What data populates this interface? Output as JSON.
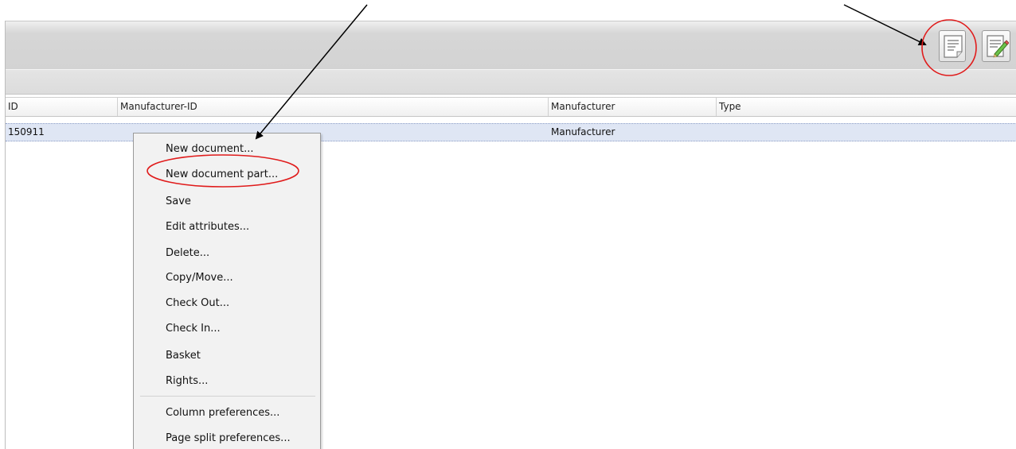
{
  "toolbar": {
    "buttons": [
      {
        "icon": "document-icon",
        "tooltip": ""
      },
      {
        "icon": "edit-document-icon",
        "tooltip": ""
      }
    ]
  },
  "table": {
    "columns": [
      "ID",
      "Manufacturer-ID",
      "Manufacturer",
      "Type"
    ],
    "rows": [
      {
        "id": "150911",
        "manufacturer_id": "",
        "manufacturer": "Manufacturer",
        "type": ""
      }
    ]
  },
  "context_menu": {
    "items": [
      "New document...",
      "New document part...",
      "Save",
      "Edit attributes...",
      "Delete...",
      "Copy/Move...",
      "Check Out...",
      "Check In...",
      "Basket",
      "Rights...",
      "Column preferences...",
      "Page split preferences..."
    ]
  },
  "annotation_colors": {
    "circle": "#e01b1b",
    "arrow": "#000000"
  }
}
